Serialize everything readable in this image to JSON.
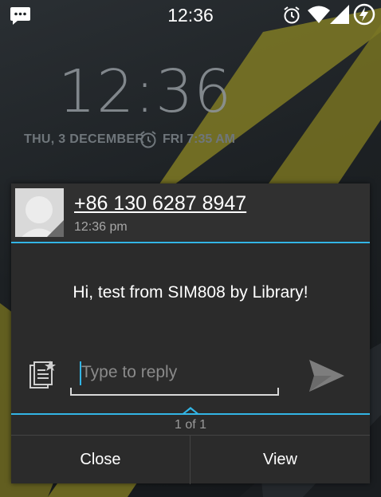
{
  "status_bar": {
    "time": "12:36",
    "icons": [
      "messaging-icon",
      "alarm-icon",
      "wifi-icon",
      "cell-signal-icon",
      "battery-charging-icon"
    ]
  },
  "lock_screen": {
    "time": "12:36",
    "date": "THU, 3 DECEMBER",
    "next_alarm": "FRI 7:35 AM"
  },
  "popup": {
    "sender": "+86 130 6287 8947",
    "received_time": "12:36 pm",
    "message": "Hi, test from SIM808 by Library!",
    "reply_placeholder": "Type to reply",
    "reply_value": "",
    "pager": "1 of 1",
    "close_label": "Close",
    "view_label": "View"
  },
  "colors": {
    "accent": "#33b5e5",
    "wallpaper_yellow": "#8a8024"
  }
}
